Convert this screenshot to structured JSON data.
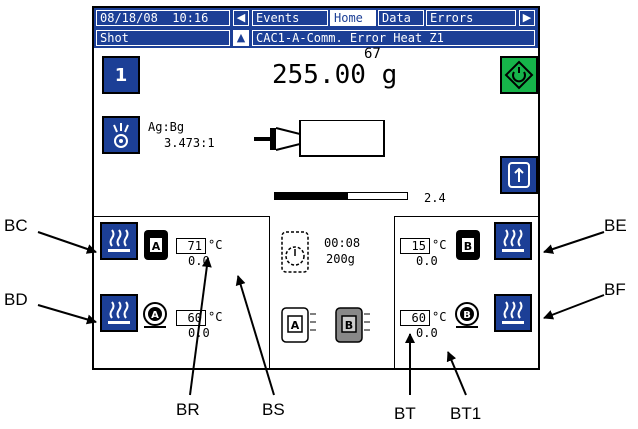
{
  "header": {
    "date": "08/18/08",
    "time": "10:16",
    "tabs": [
      {
        "label": "Events",
        "selected": false
      },
      {
        "label": "Home",
        "selected": true
      },
      {
        "label": "Data",
        "selected": false
      },
      {
        "label": "Errors",
        "selected": false
      }
    ],
    "mode": "Shot",
    "error_message": "CAC1-A-Comm. Error Heat Z1"
  },
  "main": {
    "shot_number": "1",
    "shot_count": "67",
    "shot_weight": "255.00 g",
    "ratio_label": "Ag:Bg",
    "ratio_value": "3.473:1",
    "progress_value": "2.4",
    "progress_fraction": 0.55
  },
  "heat": {
    "a_tank_temp": "71",
    "a_tank_temp_actual": "0.0",
    "a_pump_temp": "60",
    "a_pump_temp_actual": "0.0",
    "b_tank_temp": "15",
    "b_tank_temp_actual": "0.0",
    "b_pump_temp": "60",
    "b_pump_temp_actual": "0.0",
    "unit": "°C"
  },
  "timer": {
    "time": "00:08",
    "amount": "200g"
  },
  "tank_labels": {
    "a": "A",
    "b": "B"
  },
  "callouts": {
    "bc": "BC",
    "bd": "BD",
    "be": "BE",
    "bf": "BF",
    "br": "BR",
    "bs": "BS",
    "bt": "BT",
    "bt1": "BT1"
  },
  "colors": {
    "header_blue": "#1c3f96",
    "start_green": "#16b44a"
  }
}
